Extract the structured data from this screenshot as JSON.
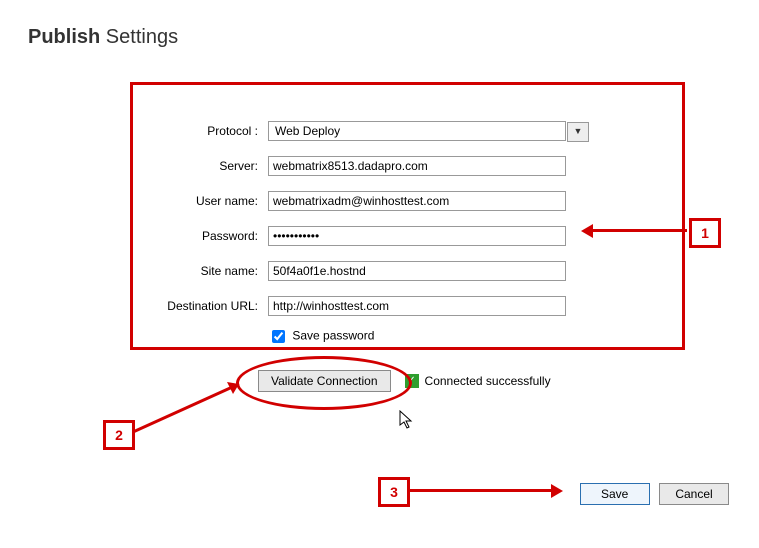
{
  "title_bold": "Publish",
  "title_rest": "Settings",
  "labels": {
    "protocol": "Protocol :",
    "server": "Server:",
    "username": "User name:",
    "password": "Password:",
    "sitename": "Site name:",
    "desturl": "Destination URL:",
    "savepwd": "Save password"
  },
  "values": {
    "protocol": "Web Deploy",
    "server": "webmatrix8513.dadapro.com",
    "username": "webmatrixadm@winhosttest.com",
    "password": "•••••••••••",
    "sitename": "50f4a0f1e.hostnd",
    "desturl": "http://winhosttest.com"
  },
  "buttons": {
    "validate": "Validate Connection",
    "save": "Save",
    "cancel": "Cancel"
  },
  "status": "Connected successfully",
  "callouts": {
    "one": "1",
    "two": "2",
    "three": "3"
  }
}
